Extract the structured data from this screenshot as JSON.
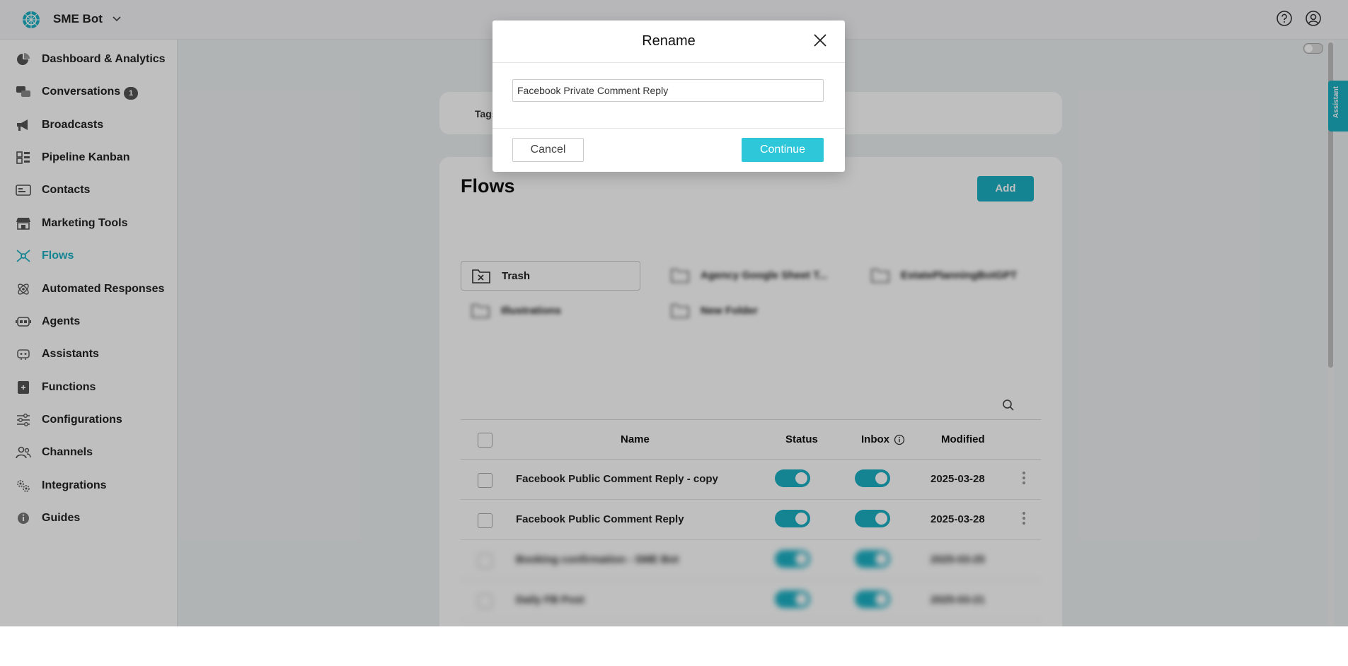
{
  "app": {
    "name": "SME Bot"
  },
  "sidebar": {
    "items": [
      {
        "label": "Dashboard & Analytics",
        "icon": "pie-chart-icon"
      },
      {
        "label": "Conversations",
        "icon": "chat-bubbles-icon",
        "badge": "1"
      },
      {
        "label": "Broadcasts",
        "icon": "megaphone-icon"
      },
      {
        "label": "Pipeline Kanban",
        "icon": "kanban-icon"
      },
      {
        "label": "Contacts",
        "icon": "contact-card-icon"
      },
      {
        "label": "Marketing Tools",
        "icon": "storefront-icon"
      },
      {
        "label": "Flows",
        "icon": "flow-network-icon",
        "active": true
      },
      {
        "label": "Automated Responses",
        "icon": "atom-icon"
      },
      {
        "label": "Agents",
        "icon": "robot-icon"
      },
      {
        "label": "Assistants",
        "icon": "assistant-bot-icon"
      },
      {
        "label": "Functions",
        "icon": "function-box-icon"
      },
      {
        "label": "Configurations",
        "icon": "sliders-icon"
      },
      {
        "label": "Channels",
        "icon": "people-icon"
      },
      {
        "label": "Integrations",
        "icon": "gears-icon"
      },
      {
        "label": "Guides",
        "icon": "info-icon"
      }
    ]
  },
  "tags": {
    "label": "Tags"
  },
  "flows": {
    "title": "Flows",
    "add_label": "Add",
    "folders": [
      {
        "label": "Trash"
      },
      {
        "label": "Agency Google Sheet T..."
      },
      {
        "label": "EstatePlanningBotGPT"
      },
      {
        "label": "Illustrations"
      },
      {
        "label": "New Folder"
      }
    ],
    "columns": {
      "name": "Name",
      "status": "Status",
      "inbox": "Inbox",
      "modified": "Modified"
    },
    "rows": [
      {
        "name": "Facebook Public Comment Reply - copy",
        "modified": "2025-03-28"
      },
      {
        "name": "Facebook Public Comment Reply",
        "modified": "2025-03-28"
      },
      {
        "name": "Booking confirmation - SME Bot",
        "modified": "2025-03-25"
      },
      {
        "name": "Daily FB Post",
        "modified": "2025-03-21"
      }
    ]
  },
  "assistant_tab": {
    "label": "Assistant"
  },
  "modal": {
    "title": "Rename",
    "input_value": "Facebook Private Comment Reply",
    "cancel_label": "Cancel",
    "continue_label": "Continue"
  },
  "colors": {
    "accent": "#1bb1c5",
    "continue": "#2ec6d9"
  }
}
